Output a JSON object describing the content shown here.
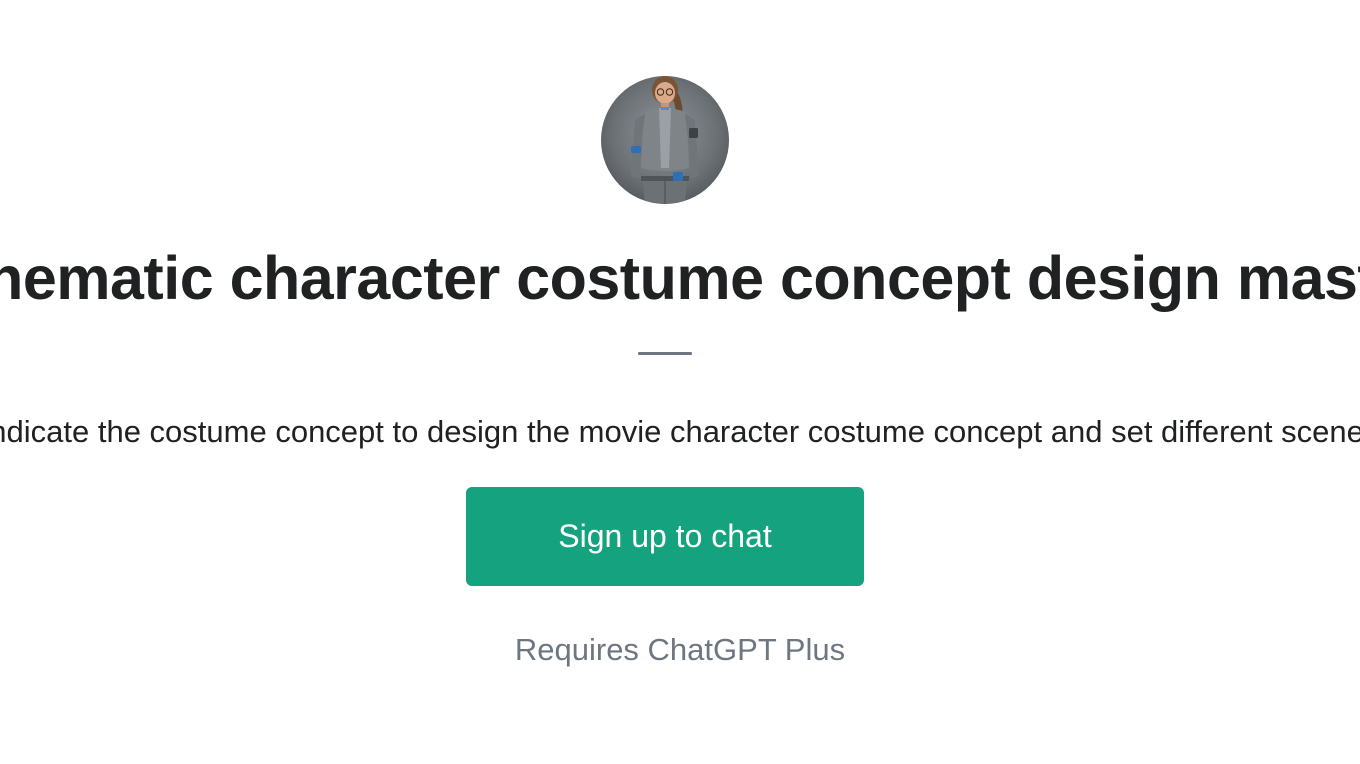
{
  "header": {
    "title": "Cinematic character costume concept design master"
  },
  "main": {
    "description": "Indicate the costume concept to design the movie character costume concept and set different scenes"
  },
  "actions": {
    "signup_label": "Sign up to chat",
    "requirement": "Requires ChatGPT Plus"
  },
  "colors": {
    "accent": "#15a37f",
    "title_text": "#202123",
    "muted_text": "#6e7781"
  }
}
